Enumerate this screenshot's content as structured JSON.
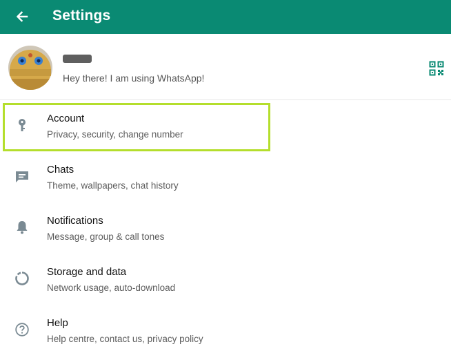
{
  "app_bar": {
    "title": "Settings",
    "back_icon": "arrow-left-icon",
    "background_color": "#0a8a73"
  },
  "profile": {
    "name": "",
    "name_redacted": true,
    "status": "Hey there! I am using WhatsApp!",
    "qr_icon": "qr-code-icon",
    "accent_color": "#0a8a73"
  },
  "menu_items": [
    {
      "title": "Account",
      "subtitle": "Privacy, security, change number",
      "icon": "key-icon",
      "highlighted": true
    },
    {
      "title": "Chats",
      "subtitle": "Theme, wallpapers, chat history",
      "icon": "chat-icon"
    },
    {
      "title": "Notifications",
      "subtitle": "Message, group & call tones",
      "icon": "bell-icon"
    },
    {
      "title": "Storage and data",
      "subtitle": "Network usage, auto-download",
      "icon": "storage-icon"
    },
    {
      "title": "Help",
      "subtitle": "Help centre, contact us, privacy policy",
      "icon": "help-icon"
    }
  ],
  "highlight_color": "#b4de2c",
  "icon_color": "#7a8a93"
}
